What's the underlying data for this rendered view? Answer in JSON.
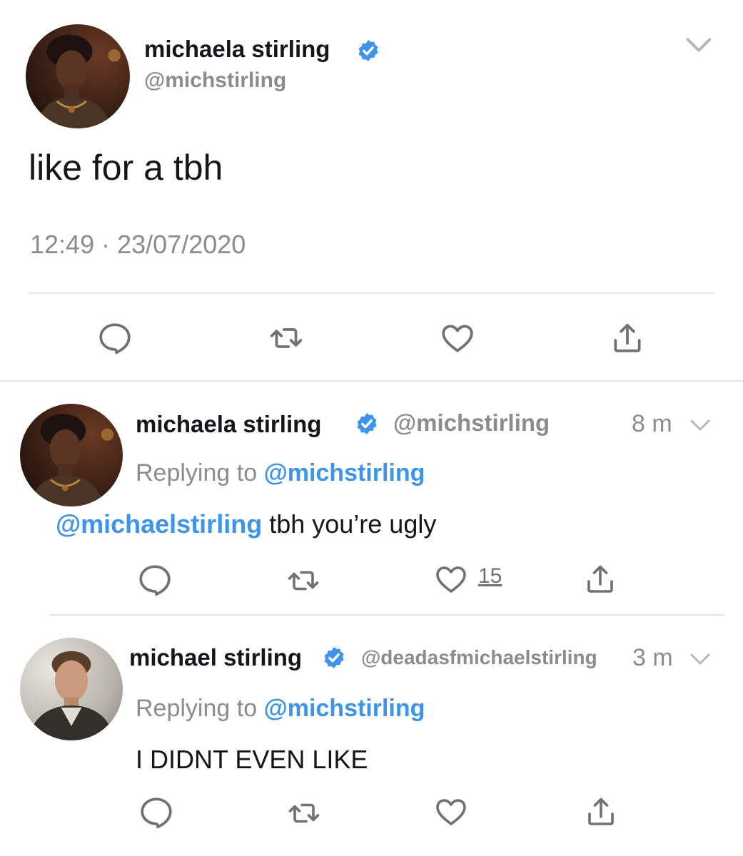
{
  "main_tweet": {
    "name": "michaela stirling",
    "handle": "@michstirling",
    "text": "like for a tbh",
    "time": "12:49",
    "separator": "·",
    "date": "23/07/2020"
  },
  "replies": [
    {
      "name": "michaela stirling",
      "handle": "@michstirling",
      "age": "8 m",
      "replying_label": "Replying to",
      "replying_handle": "@michstirling",
      "mention": "@michaelstirling",
      "text": "tbh you’re ugly",
      "like_count": "15"
    },
    {
      "name": "michael stirling",
      "handle": "@deadasfmichaelstirling",
      "age": "3 m",
      "replying_label": "Replying to",
      "replying_handle": "@michstirling",
      "text": "I DIDNT EVEN LIKE"
    }
  ],
  "colors": {
    "link": "#3d94ea",
    "verified": "#3d94ea",
    "muted": "#8c8c8c",
    "icon": "#6e7276",
    "divider": "#dfe3e6"
  },
  "icons": [
    "verified-badge-icon",
    "chevron-down-icon",
    "reply-icon",
    "retweet-icon",
    "like-icon",
    "share-icon"
  ]
}
